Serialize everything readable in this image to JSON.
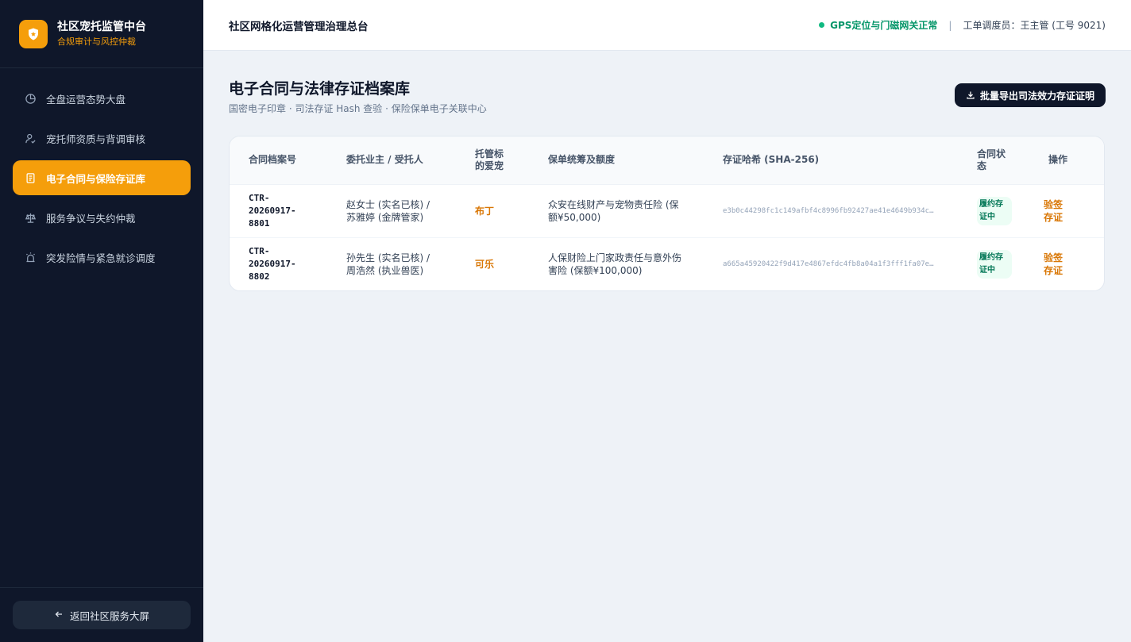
{
  "brand": {
    "title": "社区宠托监管中台",
    "subtitle": "合规审计与风控仲裁",
    "logo_icon": "shield-icon",
    "accent": "#f59e0b"
  },
  "nav": {
    "items": [
      {
        "label": "全盘运营态势大盘",
        "icon": "pie-chart-icon",
        "active": false
      },
      {
        "label": "宠托师资质与背调审核",
        "icon": "user-check-icon",
        "active": false
      },
      {
        "label": "电子合同与保险存证库",
        "icon": "document-icon",
        "active": true
      },
      {
        "label": "服务争议与失约仲裁",
        "icon": "scale-icon",
        "active": false
      },
      {
        "label": "突发险情与紧急就诊调度",
        "icon": "siren-icon",
        "active": false
      }
    ]
  },
  "footer": {
    "back_label": "返回社区服务大屏"
  },
  "topbar": {
    "title": "社区网格化运营管理治理总台",
    "status": "GPS定位与门磁网关正常",
    "separator": "|",
    "dispatcher": "工单调度员：王主管 (工号 9021)"
  },
  "page": {
    "title": "电子合同与法律存证档案库",
    "subtitle": "国密电子印章 · 司法存证 Hash 查验 · 保险保单电子关联中心",
    "export_label": "批量导出司法效力存证证明"
  },
  "table": {
    "headers": {
      "id": "合同档案号",
      "parties": "委托业主 / 受托人",
      "pet": "托管标的爱宠",
      "insurance": "保单统筹及额度",
      "hash": "存证哈希 (SHA-256)",
      "status": "合同状态",
      "action": "操作"
    },
    "rows": [
      {
        "id": "CTR-20260917-8801",
        "parties": "赵女士 (实名已核) / 苏雅婷 (金牌管家)",
        "pet": "布丁",
        "insurance": "众安在线财产与宠物责任险 (保额¥50,000)",
        "hash": "e3b0c44298fc1c149afbf4c8996fb92427ae41e4649b934c…",
        "status": "履约存证中",
        "action": "验签存证"
      },
      {
        "id": "CTR-20260917-8802",
        "parties": "孙先生 (实名已核) / 周浩然 (执业兽医)",
        "pet": "可乐",
        "insurance": "人保财险上门家政责任与意外伤害险 (保额¥100,000)",
        "hash": "a665a45920422f9d417e4867efdc4fb8a04a1f3fff1fa07e…",
        "status": "履约存证中",
        "action": "验签存证"
      }
    ]
  }
}
